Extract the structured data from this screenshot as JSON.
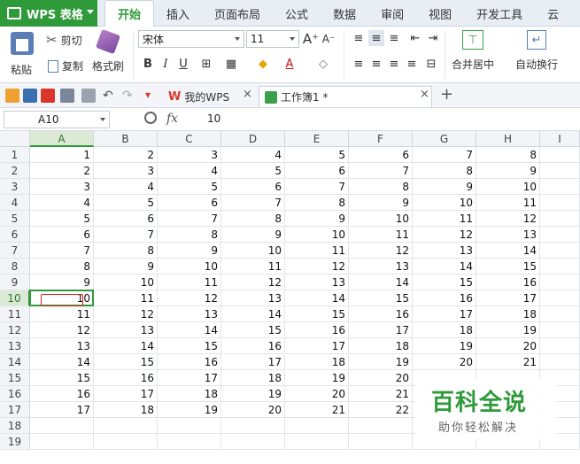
{
  "app": {
    "title": "WPS 表格"
  },
  "menu": {
    "tabs": [
      "开始",
      "插入",
      "页面布局",
      "公式",
      "数据",
      "审阅",
      "视图",
      "开发工具",
      "云"
    ]
  },
  "ribbon": {
    "paste": "粘贴",
    "cut": "剪切",
    "copy": "复制",
    "format_painter": "格式刷",
    "font_name": "宋体",
    "font_size": "11",
    "merge_center": "合并居中",
    "wrap_text": "自动换行"
  },
  "doc_tabs": {
    "home_tab": "我的WPS",
    "workbook_tab": "工作簿1 *"
  },
  "formula_bar": {
    "cell_ref": "A10",
    "fx": "fx",
    "value": "10"
  },
  "sheet": {
    "columns": [
      "A",
      "B",
      "C",
      "D",
      "E",
      "F",
      "G",
      "H",
      "I"
    ],
    "selected_column": "A",
    "selected_row": 10,
    "row_count": 19,
    "rows": [
      [
        1,
        2,
        3,
        4,
        5,
        6,
        7,
        8
      ],
      [
        2,
        3,
        4,
        5,
        6,
        7,
        8,
        9
      ],
      [
        3,
        4,
        5,
        6,
        7,
        8,
        9,
        10
      ],
      [
        4,
        5,
        6,
        7,
        8,
        9,
        10,
        11
      ],
      [
        5,
        6,
        7,
        8,
        9,
        10,
        11,
        12
      ],
      [
        6,
        7,
        8,
        9,
        10,
        11,
        12,
        13
      ],
      [
        7,
        8,
        9,
        10,
        11,
        12,
        13,
        14
      ],
      [
        8,
        9,
        10,
        11,
        12,
        13,
        14,
        15
      ],
      [
        9,
        10,
        11,
        12,
        13,
        14,
        15,
        16
      ],
      [
        10,
        11,
        12,
        13,
        14,
        15,
        16,
        17
      ],
      [
        11,
        12,
        13,
        14,
        15,
        16,
        17,
        18
      ],
      [
        12,
        13,
        14,
        15,
        16,
        17,
        18,
        19
      ],
      [
        13,
        14,
        15,
        16,
        17,
        18,
        19,
        20
      ],
      [
        14,
        15,
        16,
        17,
        18,
        19,
        20,
        21
      ],
      [
        15,
        16,
        17,
        18,
        19,
        20,
        "",
        ""
      ],
      [
        16,
        17,
        18,
        19,
        20,
        21,
        "",
        ""
      ],
      [
        17,
        18,
        19,
        20,
        21,
        22,
        "",
        ""
      ]
    ]
  },
  "watermark": {
    "title": "百科全说",
    "subtitle": "助你轻松解决"
  },
  "colors": {
    "accent": "#2f9a3a",
    "highlight": "#e02020"
  }
}
